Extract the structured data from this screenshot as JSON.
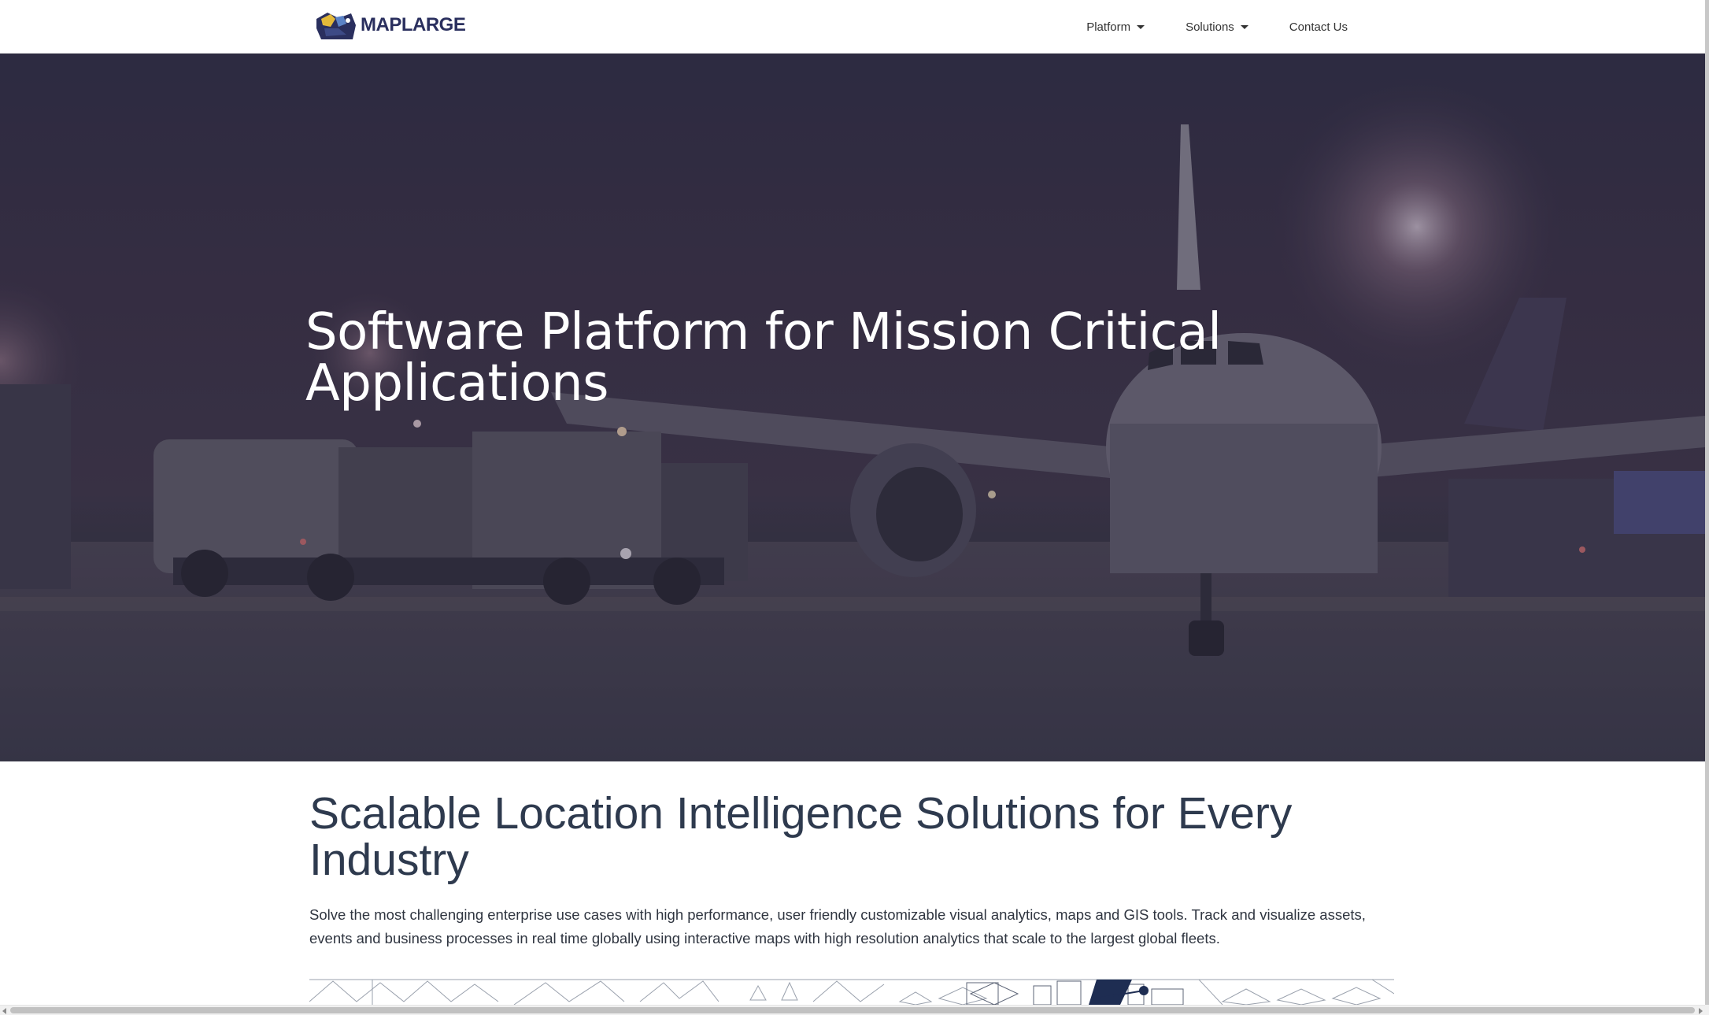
{
  "brand": {
    "name": "MAPLARGE",
    "logo_icon": "maplarge-logo-icon",
    "colors": {
      "navy": "#2a2f5e",
      "gold": "#e3b93a",
      "title_text": "#2e3a4e"
    }
  },
  "nav": {
    "items": [
      {
        "label": "Platform",
        "has_dropdown": true
      },
      {
        "label": "Solutions",
        "has_dropdown": true
      },
      {
        "label": "Contact Us",
        "has_dropdown": false
      }
    ]
  },
  "hero": {
    "title_line1": "Software Platform for Mission Critical",
    "title_line2": "Applications",
    "background": "night airport apron with airplane and fuel trucks"
  },
  "section": {
    "title_line1": "Scalable Location Intelligence Solutions for Every",
    "title_line2": "Industry",
    "body": "Solve the most challenging enterprise use cases with high performance, user friendly customizable visual analytics, maps and GIS tools. Track and visualize assets, events and business processes in real time globally using interactive maps with high resolution analytics that scale to the largest global fleets."
  }
}
